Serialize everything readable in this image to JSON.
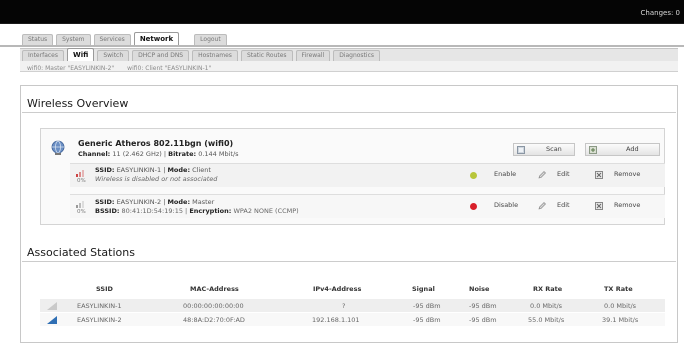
{
  "header": {
    "changes": "Changes: 0"
  },
  "tabs_main": [
    {
      "label": "Status"
    },
    {
      "label": "System"
    },
    {
      "label": "Services"
    },
    {
      "label": "Network",
      "active": true
    },
    {
      "label": "Logout"
    }
  ],
  "tabs_sub": [
    {
      "label": "Interfaces"
    },
    {
      "label": "Wifi",
      "active": true
    },
    {
      "label": "Switch"
    },
    {
      "label": "DHCP and DNS"
    },
    {
      "label": "Hostnames"
    },
    {
      "label": "Static Routes"
    },
    {
      "label": "Firewall"
    },
    {
      "label": "Diagnostics"
    }
  ],
  "tabs_wifi": [
    {
      "label": "wifi0: Master \"EASYLINKIN-2\""
    },
    {
      "label": "wifi0: Client \"EASYLINKIN-1\""
    }
  ],
  "wireless_overview": {
    "title": "Wireless Overview",
    "device": {
      "name": "Generic Atheros 802.11bgn (wifi0)",
      "channel_label": "Channel:",
      "channel_value": "11 (2.462 GHz)",
      "bitrate_label": "Bitrate:",
      "bitrate_value": "0.144 Mbit/s",
      "scan_label": "Scan",
      "add_label": "Add"
    },
    "interfaces": [
      {
        "pct": "0%",
        "ssid_label": "SSID:",
        "ssid": "EASYLINKIN-1",
        "mode_label": "Mode:",
        "mode": "Client",
        "line2": "Wireless is disabled or not associated",
        "toggle_label": "Enable",
        "toggle_color": "#b8c63a",
        "edit_label": "Edit",
        "remove_label": "Remove"
      },
      {
        "pct": "0%",
        "ssid_label": "SSID:",
        "ssid": "EASYLINKIN-2",
        "mode_label": "Mode:",
        "mode": "Master",
        "bssid_label": "BSSID:",
        "bssid": "80:41:1D:54:19:15",
        "enc_label": "Encryption:",
        "enc": "WPA2 NONE (CCMP)",
        "toggle_label": "Disable",
        "toggle_color": "#d8202a",
        "edit_label": "Edit",
        "remove_label": "Remove"
      }
    ]
  },
  "associated_stations": {
    "title": "Associated Stations",
    "columns": [
      "SSID",
      "MAC-Address",
      "IPv4-Address",
      "Signal",
      "Noise",
      "RX Rate",
      "TX Rate"
    ],
    "rows": [
      [
        "EASYLINKIN-1",
        "00:00:00:00:00:00",
        "?",
        "-95 dBm",
        "-95 dBm",
        "0.0 Mbit/s",
        "0.0 Mbit/s"
      ],
      [
        "EASYLINKIN-2",
        "48:8A:D2:70:0F:AD",
        "192.168.1.101",
        "-95 dBm",
        "-95 dBm",
        "55.0 Mbit/s",
        "39.1 Mbit/s"
      ]
    ]
  },
  "colors": {
    "topbar": "#050505",
    "accent_blue": "#2f6fb4"
  }
}
